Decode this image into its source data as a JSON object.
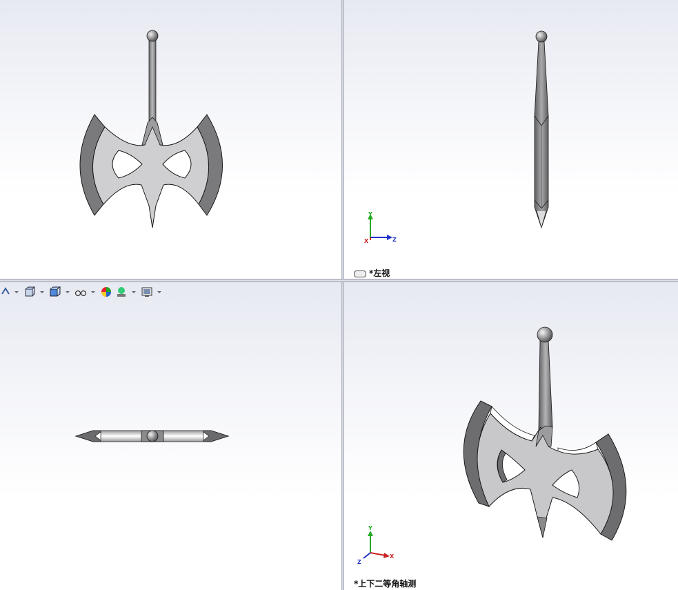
{
  "views": {
    "top_right": {
      "label": "*左视"
    },
    "bottom_right": {
      "label": "*上下二等角轴测"
    }
  },
  "triad": {
    "x": "X",
    "y": "Y",
    "z": "Z"
  },
  "toolbar": {
    "icons": [
      "view-orientation-icon",
      "display-style-icon",
      "section-view-icon",
      "hide-show-icon",
      "appearance-icon",
      "scene-icon",
      "view-settings-icon"
    ]
  },
  "colors": {
    "model_face": "#cfcfd1",
    "model_dark": "#7a7a7c",
    "model_edge": "#1a1a1a",
    "axis_x": "#cc2222",
    "axis_y": "#22aa22",
    "axis_z": "#2233cc"
  }
}
